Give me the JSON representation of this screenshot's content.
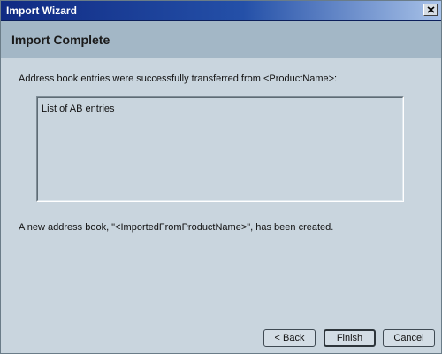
{
  "window": {
    "title": "Import Wizard"
  },
  "header": {
    "title": "Import Complete"
  },
  "content": {
    "intro": "Address book entries were successfully transferred from <ProductName>:",
    "entries": [
      "List of AB entries"
    ],
    "created_message": "A new address book, \"<ImportedFromProductName>\", has been created."
  },
  "buttons": {
    "back": "< Back",
    "finish": "Finish",
    "cancel": "Cancel"
  },
  "colors": {
    "titlebar_start": "#102a83",
    "titlebar_end": "#a8c2e8",
    "header_band": "#a3b7c6",
    "window_background": "#c9d5de"
  },
  "icons": {
    "close": "close-icon"
  }
}
